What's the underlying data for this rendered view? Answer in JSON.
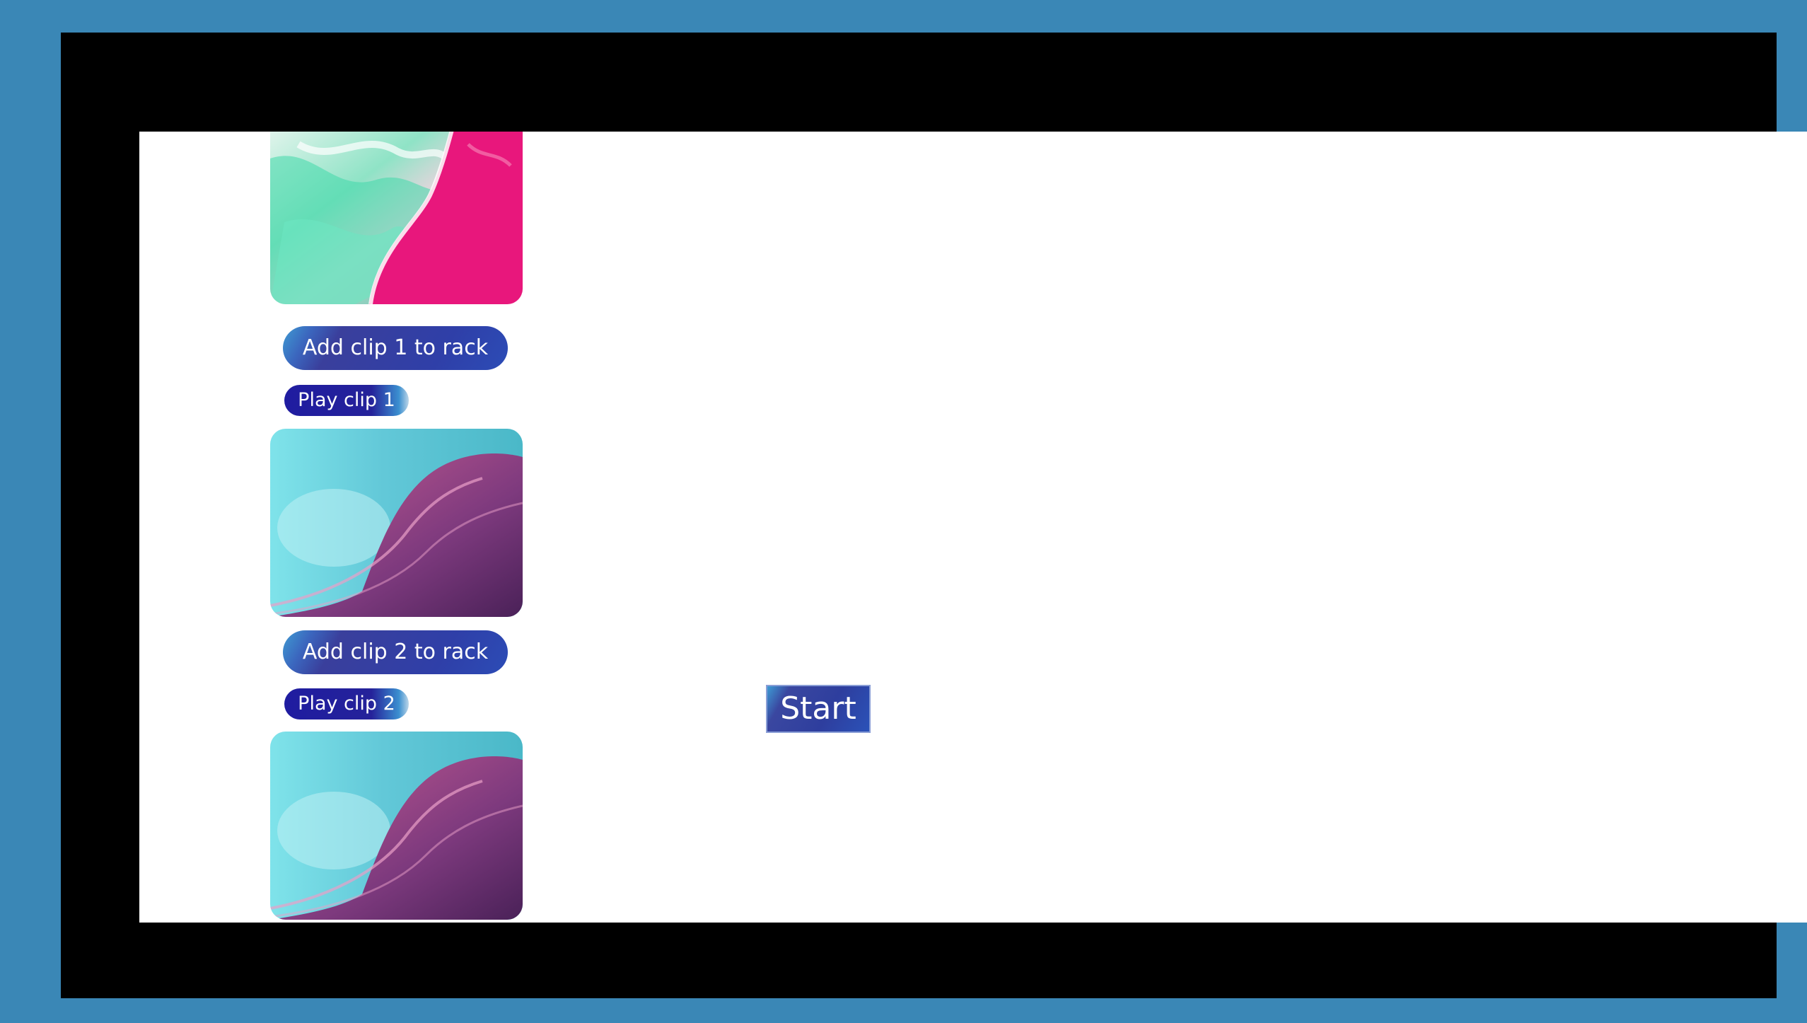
{
  "clips": [
    {
      "image_icon": "marble-pink-teal-image",
      "add_label": "Add clip 1 to rack",
      "play_label": "Play clip 1"
    },
    {
      "image_icon": "wave-pink-cyan-image",
      "add_label": "Add clip 2 to rack",
      "play_label": "Play clip 2"
    },
    {
      "image_icon": "wave-pink-cyan-image"
    }
  ],
  "start_label": "Start",
  "colors": {
    "frame": "#3a87b6",
    "letterbox": "#000000",
    "page": "#ffffff",
    "button": "#2f3fa8",
    "play_button": "#1f1ca0"
  }
}
